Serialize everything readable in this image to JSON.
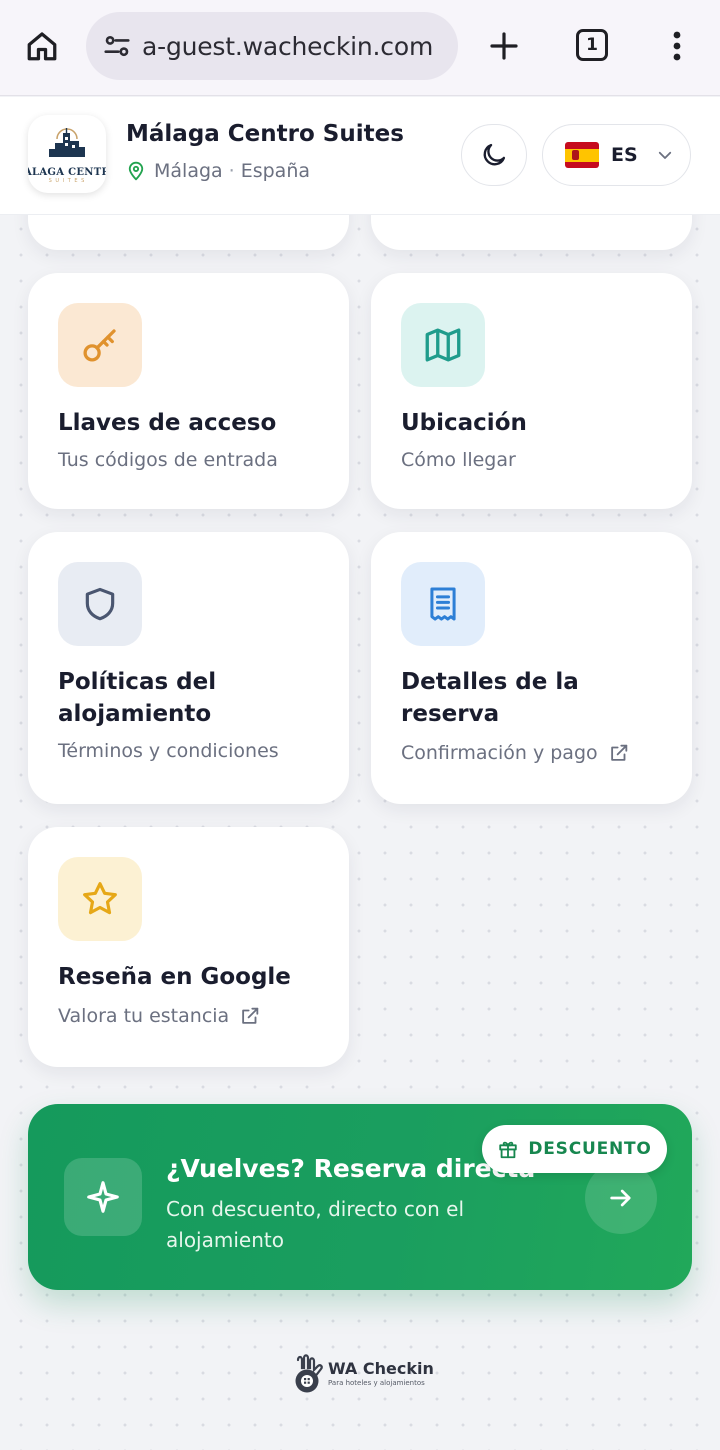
{
  "browser": {
    "url": "a-guest.wacheckin.com",
    "tab_count": "1"
  },
  "header": {
    "logo_text": "ALAGA CENTR",
    "logo_sub": "S U I T E S",
    "hotel_name": "Málaga Centro Suites",
    "city": "Málaga",
    "separator": "·",
    "country": "España",
    "language_code": "ES"
  },
  "cards": [
    {
      "id": "keys",
      "title": "Llaves de acceso",
      "subtitle": "Tus códigos de entrada",
      "icon": "key-icon",
      "icon_color": "#e0922e",
      "icon_bg": "#fbe8d3",
      "external": false
    },
    {
      "id": "location",
      "title": "Ubicación",
      "subtitle": "Cómo llegar",
      "icon": "map-icon",
      "icon_color": "#1f9c8c",
      "icon_bg": "#dcf3f0",
      "external": false
    },
    {
      "id": "policies",
      "title": "Políticas del alojamiento",
      "subtitle": "Términos y condiciones",
      "icon": "shield-icon",
      "icon_color": "#4a5670",
      "icon_bg": "#e8ecf3",
      "external": false
    },
    {
      "id": "booking",
      "title": "Detalles de la reserva",
      "subtitle": "Confirmación y pago",
      "icon": "receipt-icon",
      "icon_color": "#2d7fd6",
      "icon_bg": "#e1edfb",
      "external": true
    },
    {
      "id": "review",
      "title": "Reseña en Google",
      "subtitle": "Valora tu estancia",
      "icon": "star-icon",
      "icon_color": "#e6a817",
      "icon_bg": "#fcf1d3",
      "external": true
    }
  ],
  "promo": {
    "title": "¿Vuelves? Reserva directa",
    "subtitle": "Con descuento, directo con el alojamiento",
    "badge": "DESCUENTO",
    "color": "#169b5c"
  },
  "footer": {
    "brand": "WA Checkin",
    "tagline": "Para hoteles y alojamientos"
  }
}
